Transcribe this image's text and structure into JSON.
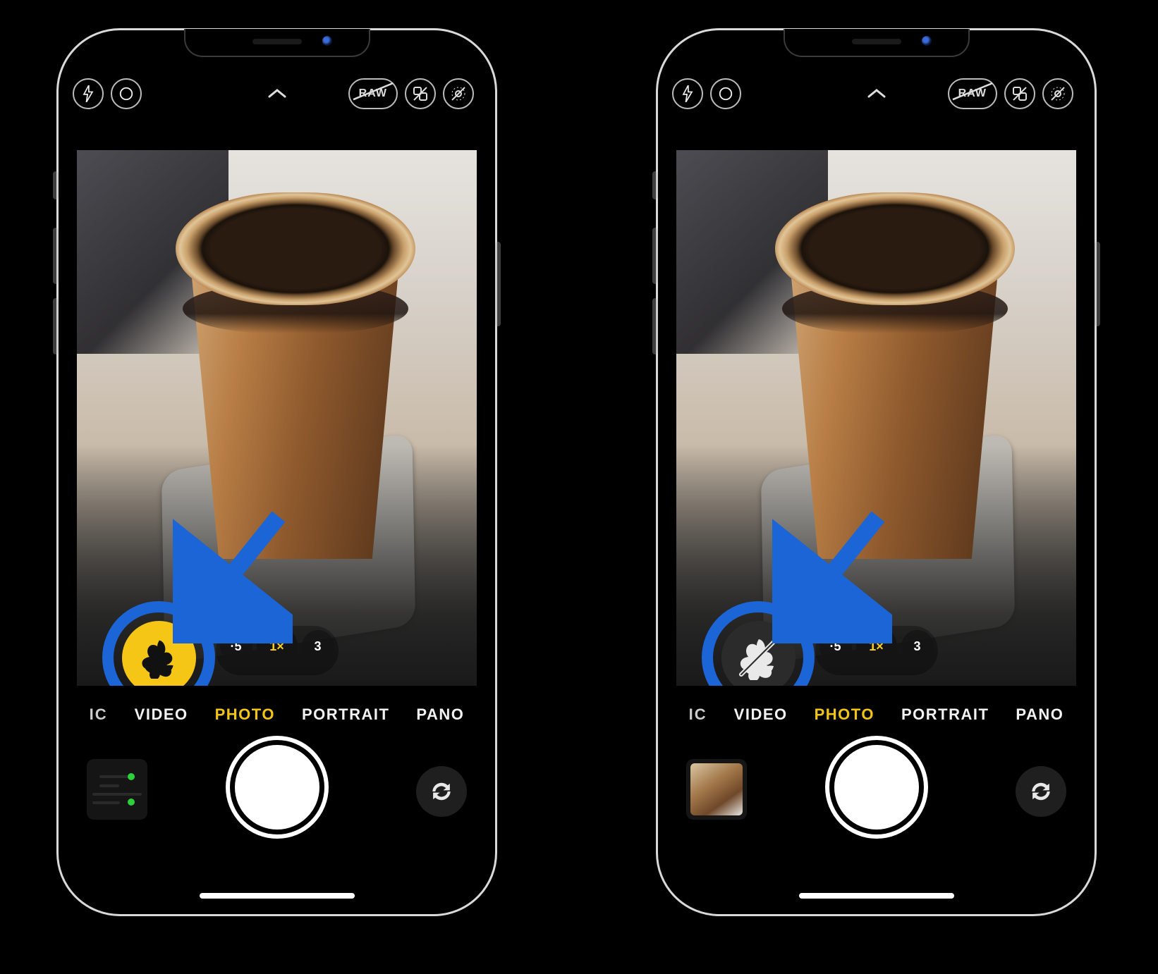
{
  "topbar": {
    "raw_label": "RAW"
  },
  "zoom": {
    "options": [
      "·5",
      "1×",
      "3"
    ],
    "active_index": 1
  },
  "modes": {
    "partial_first": "IC",
    "items": [
      "VIDEO",
      "PHOTO",
      "PORTRAIT",
      "PANO"
    ],
    "selected_index": 1
  },
  "annotation": {
    "left": {
      "macro_state": "on"
    },
    "right": {
      "macro_state": "off"
    }
  },
  "colors": {
    "accent_yellow": "#ffcf1b",
    "annotation_blue": "#1b65d6",
    "macro_yellow": "#f5c615"
  }
}
